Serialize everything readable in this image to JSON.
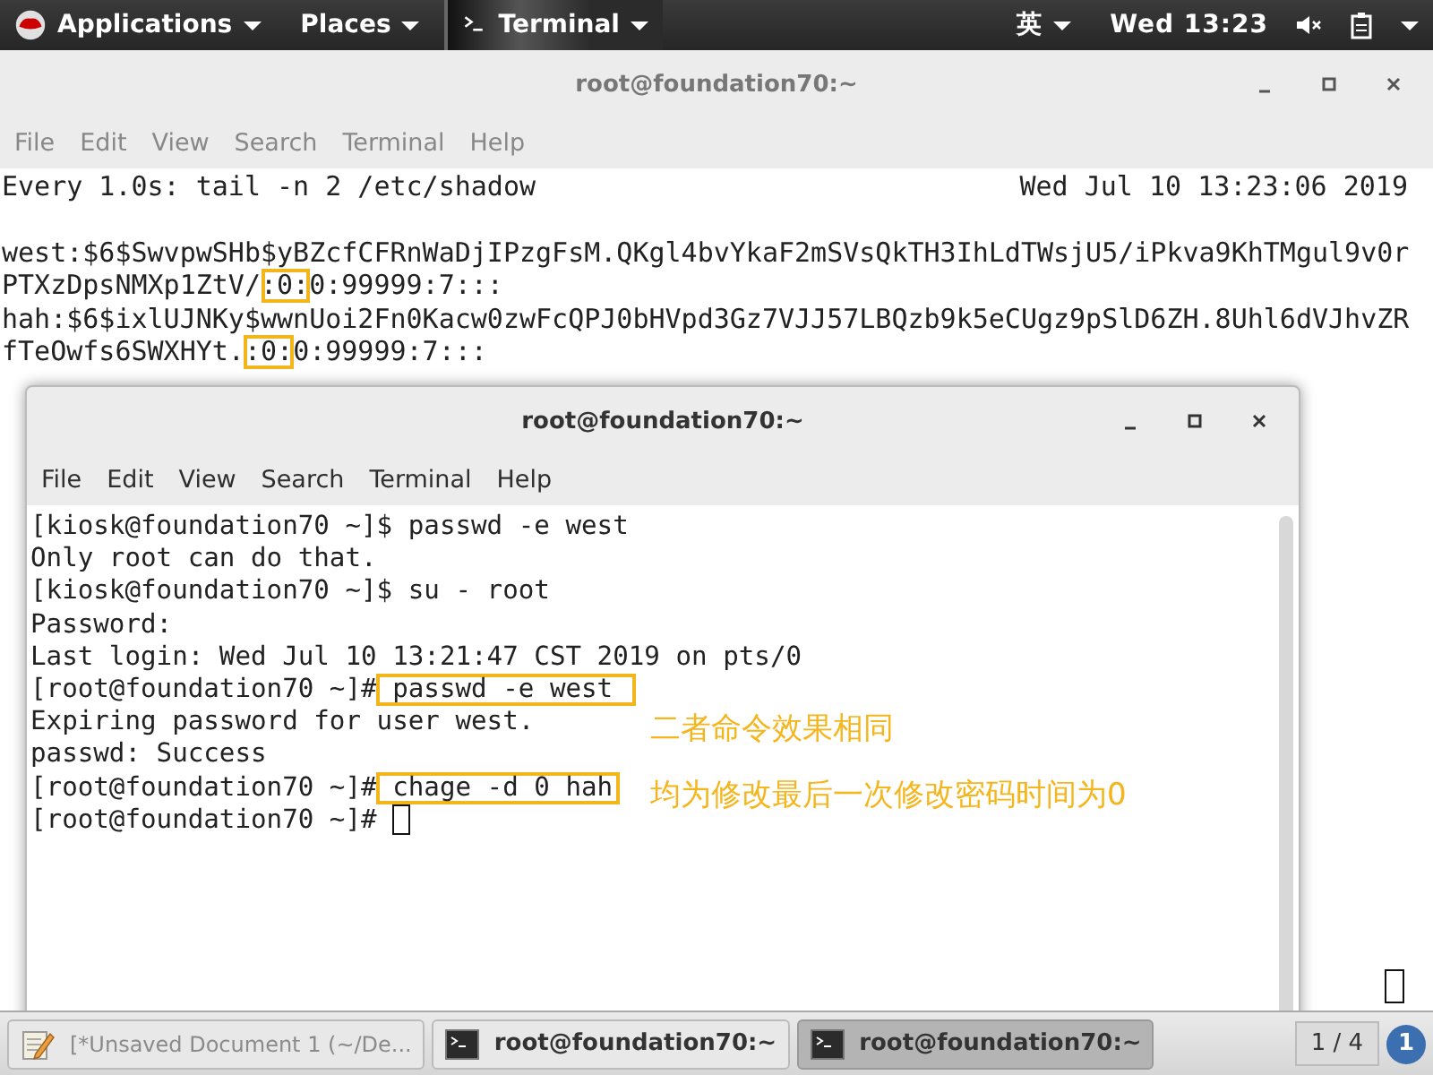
{
  "top_bar": {
    "applications_menu": "Applications",
    "places_menu": "Places",
    "app_menu": "Terminal",
    "input_method": "英",
    "clock": "Wed 13:23"
  },
  "back_window": {
    "title": "root@foundation70:~",
    "menu": [
      "File",
      "Edit",
      "View",
      "Search",
      "Terminal",
      "Help"
    ],
    "header": {
      "command": "Every 1.0s: tail -n 2 /etc/shadow",
      "time": "Wed Jul 10 13:23:06 2019"
    },
    "lines": [
      {
        "segments": [
          {
            "text": "west:$6$SwvpwSHb$yBZcfCFRnWaDjIPzgFsM.QKgl4bvYkaF2mSVsQkTH3IhLdTWsjU5/iPkva9KhTMgul9v0r",
            "highlight": false
          }
        ]
      },
      {
        "segments": [
          {
            "text": "PTXzDpsNMXp1ZtV/",
            "highlight": false
          },
          {
            "text": ":0:",
            "highlight": true
          },
          {
            "text": "0:99999:7:::",
            "highlight": false
          }
        ]
      },
      {
        "segments": [
          {
            "text": "hah:$6$ixlUJNKy$wwnUoi2Fn0Kacw0zwFcQPJ0bHVpd3Gz7VJJ57LBQzb9k5eCUgz9pSlD6ZH.8Uhl6dVJhvZR",
            "highlight": false
          }
        ]
      },
      {
        "segments": [
          {
            "text": "fTeOwfs6SWXHYt.",
            "highlight": false
          },
          {
            "text": ":0:",
            "highlight": true
          },
          {
            "text": "0:99999:7:::",
            "highlight": false
          }
        ]
      }
    ]
  },
  "front_window": {
    "title": "root@foundation70:~",
    "menu": [
      "File",
      "Edit",
      "View",
      "Search",
      "Terminal",
      "Help"
    ],
    "lines": [
      {
        "segments": [
          {
            "text": "[kiosk@foundation70 ~]$ passwd -e west",
            "highlight": false
          }
        ]
      },
      {
        "segments": [
          {
            "text": "Only root can do that.",
            "highlight": false
          }
        ]
      },
      {
        "segments": [
          {
            "text": "[kiosk@foundation70 ~]$ su - root",
            "highlight": false
          }
        ]
      },
      {
        "segments": [
          {
            "text": "Password:",
            "highlight": false
          }
        ]
      },
      {
        "segments": [
          {
            "text": "Last login: Wed Jul 10 13:21:47 CST 2019 on pts/0",
            "highlight": false
          }
        ]
      },
      {
        "segments": [
          {
            "text": "[root@foundation70 ~]#",
            "highlight": false
          },
          {
            "text": " passwd -e west ",
            "highlight": true
          }
        ]
      },
      {
        "segments": [
          {
            "text": "Expiring password for user west.",
            "highlight": false
          }
        ],
        "note": "二者命令效果相同"
      },
      {
        "segments": [
          {
            "text": "passwd: Success",
            "highlight": false
          }
        ]
      },
      {
        "segments": [
          {
            "text": "[root@foundation70 ~]#",
            "highlight": false
          },
          {
            "text": " chage -d 0 hah",
            "highlight": true
          }
        ],
        "note": "均为修改最后一次修改密码时间为0"
      },
      {
        "segments": [
          {
            "text": "[root@foundation70 ~]# ",
            "highlight": false
          }
        ],
        "cursor": true
      }
    ]
  },
  "taskbar": {
    "items": [
      {
        "label": "[*Unsaved Document 1 (~/De...",
        "kind": "editor",
        "selected": false,
        "minimized": true
      },
      {
        "label": "root@foundation70:~",
        "kind": "terminal",
        "selected": false,
        "minimized": false
      },
      {
        "label": "root@foundation70:~",
        "kind": "terminal",
        "selected": true,
        "minimized": false
      }
    ],
    "pager": "1 / 4",
    "notification_count": "1"
  }
}
